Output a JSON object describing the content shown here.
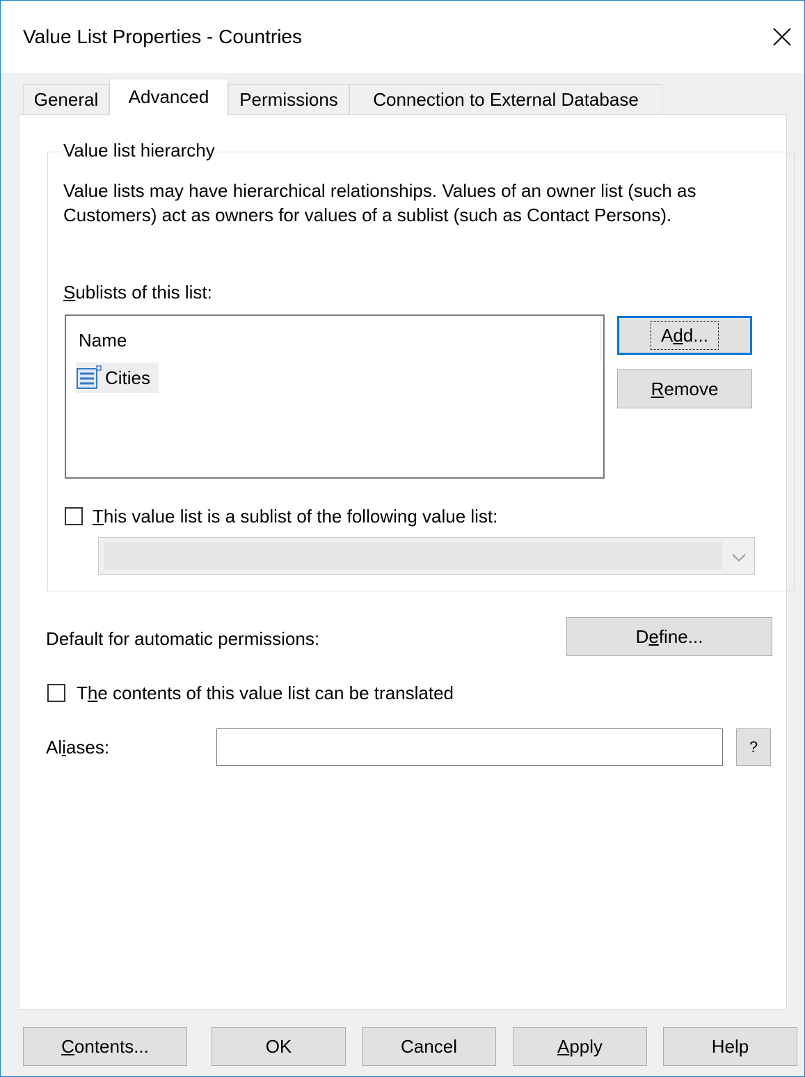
{
  "window": {
    "title": "Value List Properties - Countries"
  },
  "tabs": [
    {
      "label": "General",
      "active": false
    },
    {
      "label": "Advanced",
      "active": true
    },
    {
      "label": "Permissions",
      "active": false
    },
    {
      "label": "Connection to External Database",
      "active": false
    }
  ],
  "hierarchy": {
    "legend": "Value list hierarchy",
    "description": "Value lists may have hierarchical relationships. Values of an owner list (such as Customers) act as owners for values of a sublist (such as Contact Persons).",
    "sublists_label": {
      "pre": "",
      "ul": "S",
      "post": "ublists of this list:"
    },
    "column_header": "Name",
    "rows": [
      {
        "name": "Cities",
        "icon": "value-list-icon"
      }
    ],
    "add_button": {
      "pre": "A",
      "ul": "d",
      "post": "d..."
    },
    "remove_button": {
      "pre": "",
      "ul": "R",
      "post": "emove"
    },
    "sublist_checkbox": {
      "checked": false,
      "pre": "",
      "ul": "T",
      "post": "his value list is a sublist of the following value list:"
    },
    "parent_combo_value": ""
  },
  "permissions": {
    "label": "Default for automatic permissions:",
    "define_button": {
      "pre": "D",
      "ul": "e",
      "post": "fine..."
    }
  },
  "translate_checkbox": {
    "checked": false,
    "pre": "T",
    "ul": "h",
    "post": "e contents of this value list can be translated"
  },
  "aliases": {
    "pre": "Al",
    "ul": "i",
    "post": "ases:",
    "value": "",
    "help_button": "?"
  },
  "footer": {
    "contents": {
      "pre": "",
      "ul": "C",
      "post": "ontents..."
    },
    "ok": "OK",
    "cancel": "Cancel",
    "apply": {
      "pre": "",
      "ul": "A",
      "post": "pply"
    },
    "help": "Help"
  }
}
